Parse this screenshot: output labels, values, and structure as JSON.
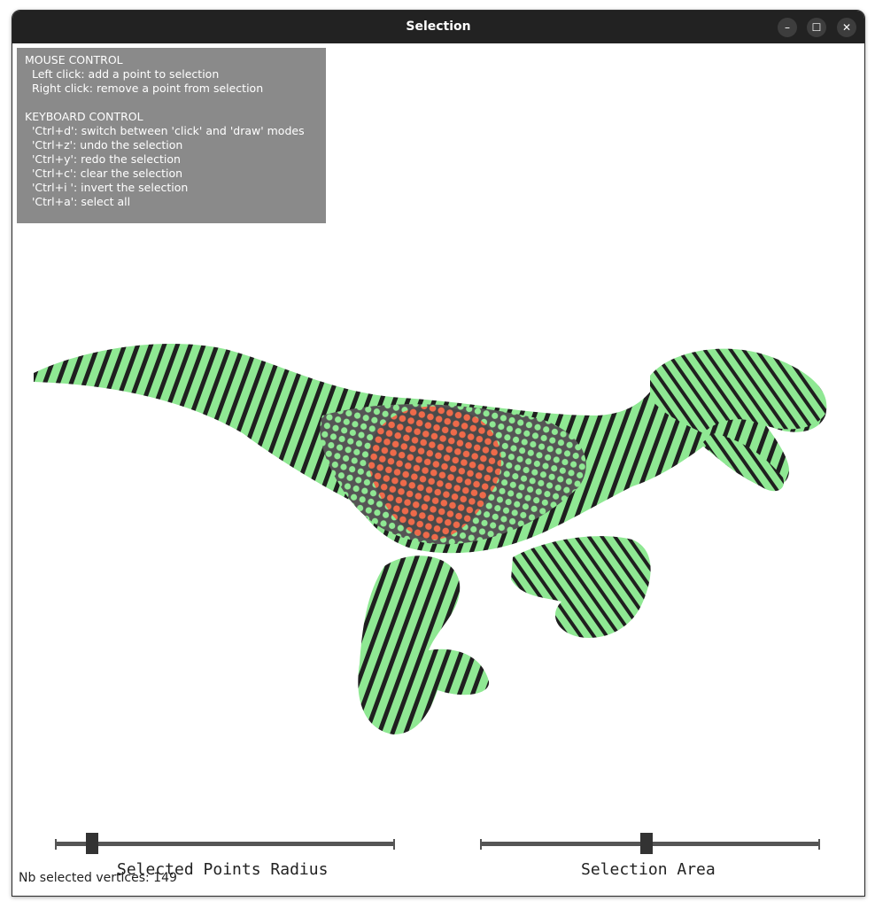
{
  "window": {
    "title": "Selection",
    "controls": {
      "minimize": "–",
      "maximize": "☐",
      "close": "✕"
    }
  },
  "help": {
    "lines": [
      "MOUSE CONTROL",
      "  Left click: add a point to selection",
      "  Right click: remove a point from selection",
      "",
      "KEYBOARD CONTROL",
      "  'Ctrl+d': switch between 'click' and 'draw' modes",
      "  'Ctrl+z': undo the selection",
      "  'Ctrl+y': redo the selection",
      "  'Ctrl+c': clear the selection",
      "  'Ctrl+i ': invert the selection",
      "  'Ctrl+a': select all"
    ]
  },
  "sliders": {
    "radius": {
      "label": "Selected Points Radius",
      "value_fraction": 0.11
    },
    "area": {
      "label": "Selection Area",
      "value_fraction": 0.49
    }
  },
  "status": {
    "text": "Nb selected vertices: 149"
  },
  "colors": {
    "unselected_vertex": "#8fe893",
    "selected_vertex": "#ee6a4a",
    "mesh": "#555555",
    "edge": "#1f1f1f",
    "help_bg": "#8a8a8a"
  },
  "mesh": {
    "icon": "velociraptor-mesh"
  }
}
